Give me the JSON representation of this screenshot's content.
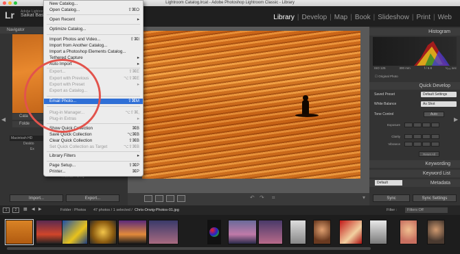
{
  "window_title": "Lightroom Catalog.lrcat - Adobe Photoshop Lightroom Classic - Library",
  "brand": {
    "logo": "Lr",
    "product": "Adobe Lightroom",
    "user": "Saikat Bas"
  },
  "modules": [
    "Library",
    "Develop",
    "Map",
    "Book",
    "Slideshow",
    "Print",
    "Web"
  ],
  "left_panel": {
    "navigator": "Navigator",
    "catalog": "Cata",
    "folders": "Folde",
    "folder_rows": [
      "Macintosh HD",
      "Deskto",
      "Ex",
      "",
      "",
      "",
      "Importing",
      "Thomas Family"
    ],
    "import_button": "Import...",
    "export_button": "Export..."
  },
  "menu": {
    "items": [
      {
        "label": "New Catalog...",
        "shortcut": ""
      },
      {
        "label": "Open Catalog...",
        "shortcut": "⇧⌘O"
      },
      {
        "label": "Open Recent",
        "shortcut": "▸"
      },
      {
        "label": "Optimize Catalog...",
        "shortcut": ""
      },
      {
        "label": "Import Photos and Video...",
        "shortcut": "⇧⌘I"
      },
      {
        "label": "Import from Another Catalog...",
        "shortcut": ""
      },
      {
        "label": "Import a Photoshop Elements Catalog...",
        "shortcut": ""
      },
      {
        "label": "Tethered Capture",
        "shortcut": "▸"
      },
      {
        "label": "Auto Import",
        "shortcut": "▸"
      },
      {
        "label": "Export...",
        "shortcut": "⇧⌘E"
      },
      {
        "label": "Export with Previous",
        "shortcut": "⌥⇧⌘E"
      },
      {
        "label": "Export with Preset",
        "shortcut": "▸"
      },
      {
        "label": "Export as Catalog...",
        "shortcut": ""
      },
      {
        "label": "Email Photo...",
        "shortcut": "⇧⌘M"
      },
      {
        "label": "Plug-in Manager...",
        "shortcut": "⌥⇧⌘,"
      },
      {
        "label": "Plug-in Extras",
        "shortcut": "▸"
      },
      {
        "label": "Show Quick Collection",
        "shortcut": "⌘B"
      },
      {
        "label": "Save Quick Collection",
        "shortcut": "⌥⌘B"
      },
      {
        "label": "Clear Quick Collection",
        "shortcut": "⇧⌘B"
      },
      {
        "label": "Set Quick Collection as Target",
        "shortcut": "⌥⇧⌘B"
      },
      {
        "label": "Library Filters",
        "shortcut": "▸"
      },
      {
        "label": "Page Setup...",
        "shortcut": "⇧⌘P"
      },
      {
        "label": "Printer...",
        "shortcut": "⌘P"
      }
    ]
  },
  "right_panel": {
    "histogram": "Histogram",
    "hist_info": [
      "ISO 125",
      "300 mm",
      "f / 6.8",
      "¹⁄₆₄₀ sec"
    ],
    "original_photo": "Original Photo",
    "quick_develop": "Quick Develop",
    "saved_preset_label": "Saved Preset",
    "saved_preset_value": "Default Settings",
    "white_balance_label": "White Balance",
    "white_balance_value": "As Shot",
    "tone_control_label": "Tone Control",
    "auto_button": "Auto",
    "exposure": "Exposure",
    "clarity": "Clarity",
    "vibrance": "Vibrance",
    "reset_all": "Reset All",
    "keywording": "Keywording",
    "keyword_list": "Keyword List",
    "metadata": "Metadata",
    "metadata_preset": "Default",
    "sync_button": "Sync",
    "sync_settings_button": "Sync Settings"
  },
  "filmbar": {
    "pages": [
      "1",
      "2"
    ],
    "source": "Folder : Photos",
    "count": "47 photos / 1 selected /",
    "filename": "Chris-Orwig-Photos-01.jpg",
    "filter_label": "Filter :",
    "filter_value": "Filters Off"
  },
  "colors": {
    "accent": "#2f6fd6",
    "annotation": "#e2534c",
    "panel": "#333333"
  }
}
